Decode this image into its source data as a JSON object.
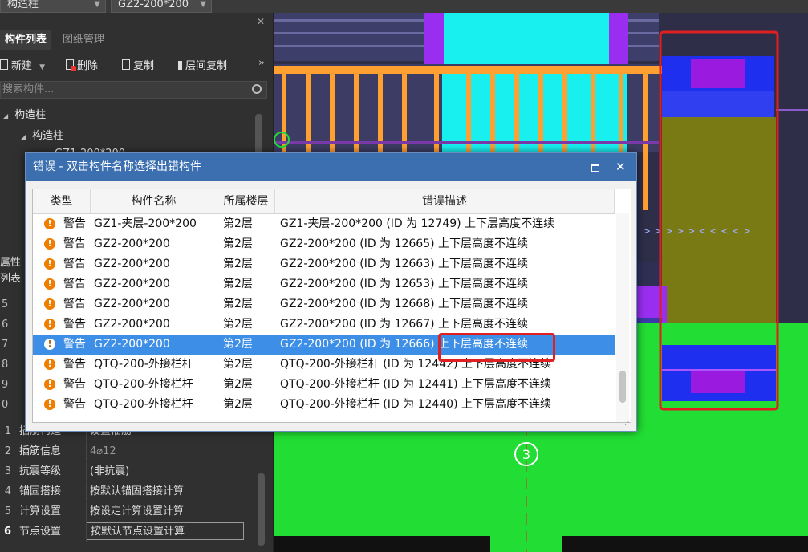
{
  "topbar": {
    "combo1": "构造柱",
    "combo2": "GZ2-200*200"
  },
  "left_panel": {
    "tabs": [
      {
        "label": "构件列表",
        "active": true
      },
      {
        "label": "图纸管理",
        "active": false
      }
    ],
    "toolbar": {
      "new": "新建",
      "delete": "删除",
      "copy": "复制",
      "floor_copy": "层间复制",
      "more": "»"
    },
    "search_placeholder": "搜索构件...",
    "tree": {
      "root": "构造柱",
      "child": "构造柱",
      "partial_item": "GZ1-200*200"
    },
    "props_header": "属性列表",
    "props_rows": [
      {
        "num": "1",
        "name": "插筋构造",
        "value": "设置插筋"
      },
      {
        "num": "2",
        "name": "插筋信息",
        "value": "4⌀12"
      },
      {
        "num": "3",
        "name": "抗震等级",
        "value": "(非抗震)"
      },
      {
        "num": "4",
        "name": "锚固搭接",
        "value": "按默认锚固搭接计算"
      },
      {
        "num": "5",
        "name": "计算设置",
        "value": "按设定计算设置计算"
      },
      {
        "num": "6",
        "name": "节点设置",
        "value": "按默认节点设置计算"
      }
    ],
    "partial_nums": [
      "5",
      "6",
      "7",
      "8",
      "9",
      "0"
    ]
  },
  "dialog": {
    "title": "错误 - 双击构件名称选择出错构件",
    "columns": [
      "类型",
      "构件名称",
      "所属楼层",
      "错误描述"
    ],
    "rows": [
      {
        "type": "警告",
        "name": "GZ1-夹层-200*200",
        "floor": "第2层",
        "desc": "GZ1-夹层-200*200  (ID 为 12749)  上下层高度不连续",
        "selected": false
      },
      {
        "type": "警告",
        "name": "GZ2-200*200",
        "floor": "第2层",
        "desc": "GZ2-200*200  (ID 为 12665)  上下层高度不连续",
        "selected": false
      },
      {
        "type": "警告",
        "name": "GZ2-200*200",
        "floor": "第2层",
        "desc": "GZ2-200*200  (ID 为 12663)  上下层高度不连续",
        "selected": false
      },
      {
        "type": "警告",
        "name": "GZ2-200*200",
        "floor": "第2层",
        "desc": "GZ2-200*200  (ID 为 12653)  上下层高度不连续",
        "selected": false
      },
      {
        "type": "警告",
        "name": "GZ2-200*200",
        "floor": "第2层",
        "desc": "GZ2-200*200  (ID 为 12668)  上下层高度不连续",
        "selected": false
      },
      {
        "type": "警告",
        "name": "GZ2-200*200",
        "floor": "第2层",
        "desc": "GZ2-200*200  (ID 为 12667)  上下层高度不连续",
        "selected": false
      },
      {
        "type": "警告",
        "name": "GZ2-200*200",
        "floor": "第2层",
        "desc": "GZ2-200*200  (ID 为 12666)  上下层高度不连续",
        "selected": true
      },
      {
        "type": "警告",
        "name": "QTQ-200-外接栏杆",
        "floor": "第2层",
        "desc": "QTQ-200-外接栏杆  (ID 为 12442)  上下层高度不连续",
        "selected": false
      },
      {
        "type": "警告",
        "name": "QTQ-200-外接栏杆",
        "floor": "第2层",
        "desc": "QTQ-200-外接栏杆  (ID 为 12441)  上下层高度不连续",
        "selected": false
      },
      {
        "type": "警告",
        "name": "QTQ-200-外接栏杆",
        "floor": "第2层",
        "desc": "QTQ-200-外接栏杆  (ID 为 12440)  上下层高度不连续",
        "selected": false
      }
    ]
  },
  "canvas": {
    "axis_label": "3"
  },
  "colors": {
    "dialog_title_bg": "#3b6fb0",
    "selection": "#3d8ee6",
    "warning_icon": "#f07d00",
    "highlight_box": "#e02020",
    "canvas_green": "#22dd33",
    "canvas_blue": "#1f2ff0",
    "canvas_cyan": "#18f0f0",
    "canvas_orange": "#ffa030",
    "canvas_olive": "#7a7a14"
  }
}
